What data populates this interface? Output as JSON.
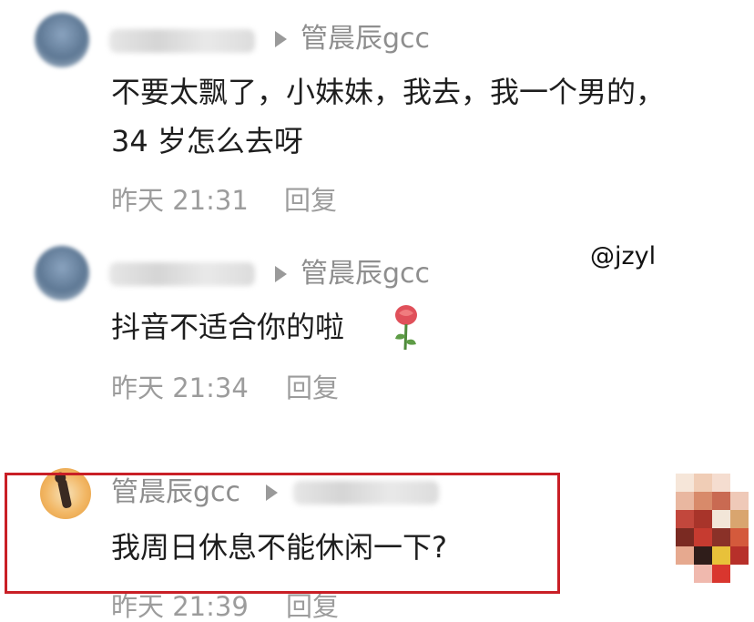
{
  "comments": [
    {
      "reply_to": "管晨辰gcc",
      "lines": [
        "不要太飘了，小妹妹，我去，我一个男的，",
        "34 岁怎么去呀"
      ],
      "time": "昨天 21:31",
      "reply_label": "回复"
    },
    {
      "reply_to": "管晨辰gcc",
      "lines": [
        "抖音不适合你的啦"
      ],
      "time": "昨天 21:34",
      "reply_label": "回复"
    },
    {
      "author": "管晨辰gcc",
      "lines": [
        "我周日休息不能休闲一下?"
      ],
      "time": "昨天 21:39",
      "reply_label": "回复"
    }
  ],
  "watermark": "@jzyl",
  "icons": {
    "reply_arrow": "triangle-right-icon",
    "emoji": "rose-icon"
  },
  "colors": {
    "highlight_border": "#c91f26",
    "meta_text": "#9c9c9c",
    "body_text": "#1e1e1e"
  }
}
